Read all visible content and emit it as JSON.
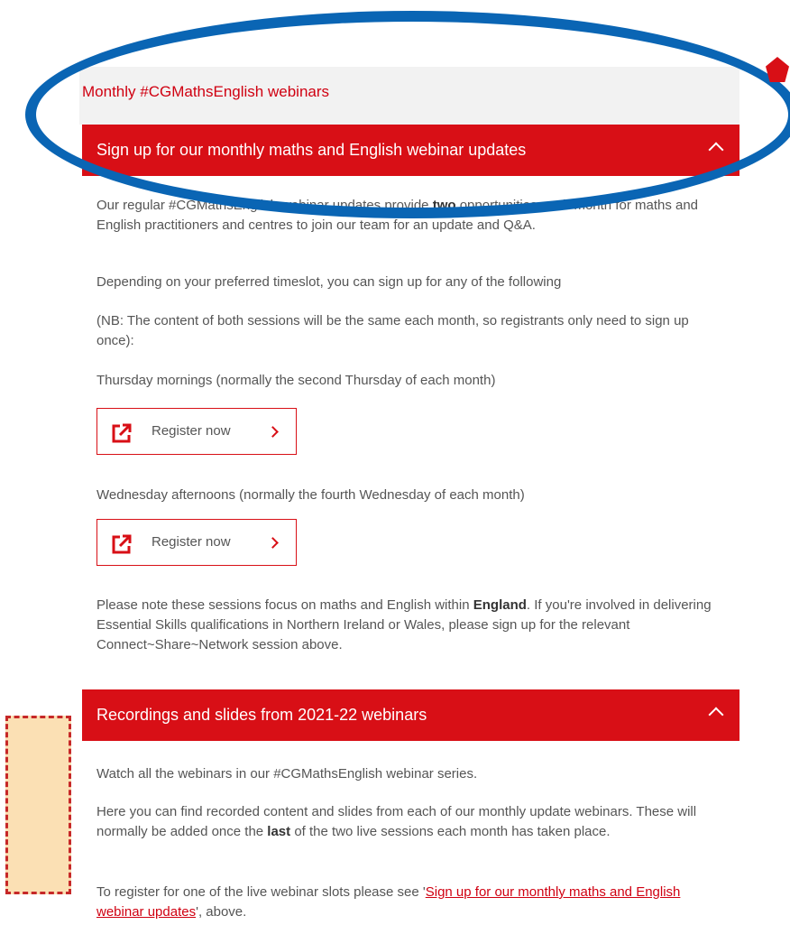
{
  "section": {
    "title": "Monthly #CGMathsEnglish webinars"
  },
  "accordion1": {
    "header": "Sign up for our monthly maths and English webinar updates",
    "intro_a": "Our regular #CGMathsEnglish webinar updates provide ",
    "intro_b": "two",
    "intro_c": " opportunities each month for maths and English practitioners and centres to join our team for an update and Q&A.",
    "p_depending": "Depending on your preferred timeslot, you can sign up for any of the following",
    "p_nb": "(NB: The content of both sessions will be the same each month, so registrants only need to sign up once):",
    "p_thursday": "Thursday mornings (normally the second Thursday of each month)",
    "btn1_label": "Register now",
    "p_wednesday": "Wednesday afternoons (normally the fourth Wednesday of each month)",
    "btn2_label": "Register now",
    "note_a": "Please note these sessions focus on maths and English within ",
    "note_b": "England",
    "note_c": ". If you're involved in delivering Essential Skills qualifications in Northern Ireland or Wales, please sign up for the relevant Connect~Share~Network session above."
  },
  "accordion2": {
    "header": "Recordings and slides from 2021-22 webinars",
    "p_watch": "Watch all the webinars in our #CGMathsEnglish webinar series.",
    "p_here_a": "Here you can find recorded content and slides from each of our monthly update webinars. These will normally be added once the ",
    "p_here_b": "last",
    "p_here_c": " of the two live sessions each month has taken place.",
    "p_reg_a": "To register for one of the live webinar slots please see '",
    "p_reg_link": "Sign up for our monthly maths and English webinar updates",
    "p_reg_c": "', above."
  },
  "icons": {
    "accordion_toggle": "chevron-up-icon",
    "button_icon": "external-link-icon",
    "button_arrow": "chevron-right-icon"
  },
  "colors": {
    "brand_red": "#d80f16",
    "annotation_blue": "#0a65b4",
    "annotation_box_fill": "#fbe0b4"
  }
}
